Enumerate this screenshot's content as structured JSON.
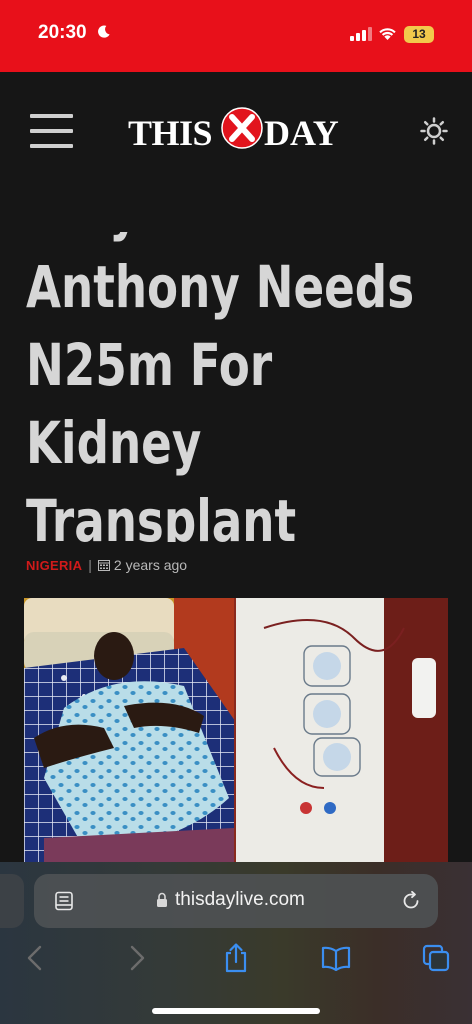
{
  "status_bar": {
    "time": "20:30",
    "battery": "13",
    "icons": [
      "moon-icon",
      "signal-icon",
      "wifi-icon",
      "battery-icon"
    ],
    "background": "#e8101a"
  },
  "header": {
    "logo_this": "THIS",
    "logo_day": "DAY",
    "icons": [
      "hamburger-menu-icon",
      "brightness-icon"
    ]
  },
  "article": {
    "headline_lines": [
      "Olayinka",
      "Anthony Needs",
      "N25m For",
      "Kidney",
      "Transplant"
    ],
    "category": "NIGERIA",
    "separator": "|",
    "date": "2 years ago"
  },
  "browser": {
    "url": "thisdaylive.com",
    "icons": [
      "reader-icon",
      "lock-icon",
      "reload-icon",
      "back-icon",
      "forward-icon",
      "share-icon",
      "bookmarks-icon",
      "tabs-icon"
    ],
    "accent": "#3b8ef0"
  }
}
